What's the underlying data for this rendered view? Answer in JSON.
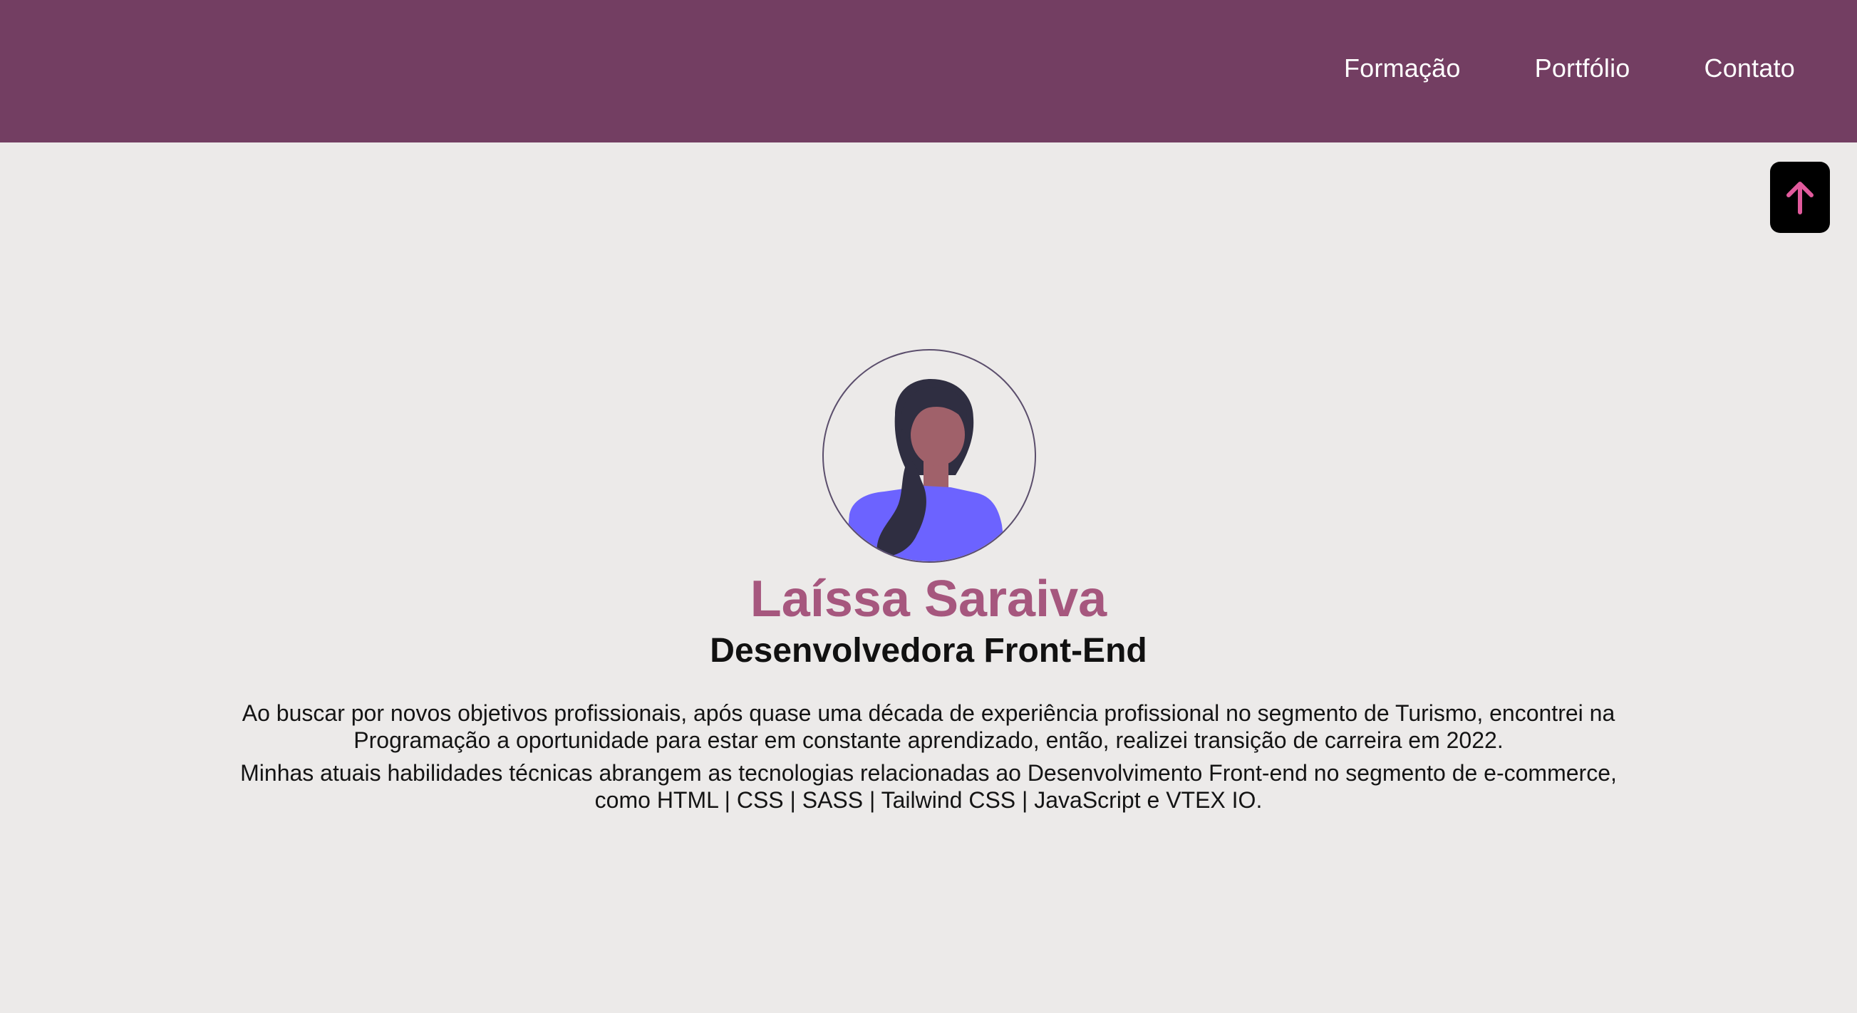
{
  "nav": {
    "items": [
      {
        "label": "Formação"
      },
      {
        "label": "Portfólio"
      },
      {
        "label": "Contato"
      }
    ]
  },
  "scroll_top": {
    "icon": "arrow-up-icon",
    "color": "#E15A9C"
  },
  "profile": {
    "avatar_icon": "woman-avatar-illustration",
    "name": "Laíssa Saraiva",
    "role": "Desenvolvedora Front-End",
    "bio": [
      "Ao buscar por novos objetivos profissionais, após quase uma década de experiência profissional no segmento de Turismo, encontrei na Programação a oportunidade para estar em constante aprendizado, então, realizei transição de carreira em 2022.",
      "Minhas atuais habilidades técnicas abrangem as tecnologias relacionadas ao Desenvolvimento Front-end no segmento de e-commerce, como HTML | CSS | SASS | Tailwind CSS | JavaScript e VTEX IO."
    ]
  },
  "colors": {
    "header": "#733E62",
    "background": "#ECEAE9",
    "name": "#A6577E",
    "shirt": "#6C63FF",
    "hair": "#2F2E41",
    "skin": "#A0616A"
  }
}
